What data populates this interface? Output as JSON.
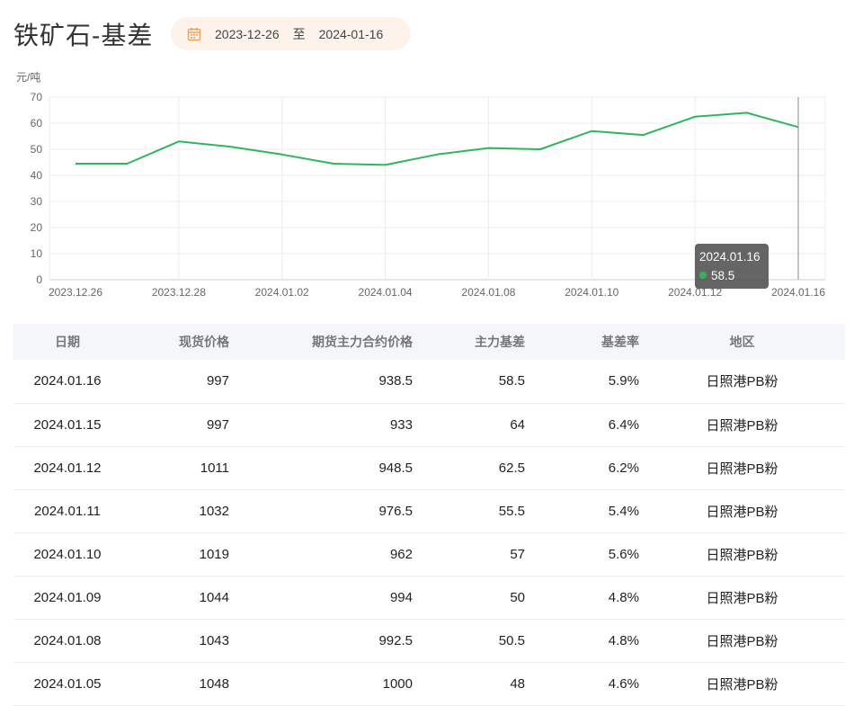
{
  "header": {
    "title": "铁矿石-基差",
    "date_start": "2023-12-26",
    "date_sep": "至",
    "date_end": "2024-01-16"
  },
  "colors": {
    "line": "#2fb55d",
    "negative_text": "#e05252",
    "date_pill_bg": "#fdf3ea",
    "calendar_icon": "#e8a25a"
  },
  "chart_data": {
    "type": "line",
    "ylabel": "元/吨",
    "ylim": [
      0,
      70
    ],
    "yticks": [
      0,
      10,
      20,
      30,
      40,
      50,
      60,
      70
    ],
    "x": [
      "2023.12.26",
      "2023.12.27",
      "2023.12.28",
      "2023.12.29",
      "2024.01.02",
      "2024.01.03",
      "2024.01.04",
      "2024.01.05",
      "2024.01.08",
      "2024.01.09",
      "2024.01.10",
      "2024.01.11",
      "2024.01.12",
      "2024.01.15",
      "2024.01.16"
    ],
    "xtick_labels": [
      "2023.12.26",
      "2023.12.28",
      "2024.01.02",
      "2024.01.04",
      "2024.01.08",
      "2024.01.10",
      "2024.01.12",
      "2024.01.16"
    ],
    "series": [
      {
        "values": [
          44.5,
          44.5,
          53,
          51,
          48,
          44.5,
          44,
          48,
          50.5,
          50,
          57,
          55.5,
          62.5,
          64,
          58.5
        ]
      }
    ],
    "grid": true,
    "tooltip": {
      "date": "2024.01.16",
      "value": "58.5"
    }
  },
  "table": {
    "headers": [
      "日期",
      "现货价格",
      "期货主力合约价格",
      "主力基差",
      "基差率",
      "地区"
    ],
    "rows": [
      [
        "2024.01.16",
        "997",
        "938.5",
        "58.5",
        "5.9%",
        "日照港PB粉"
      ],
      [
        "2024.01.15",
        "997",
        "933",
        "64",
        "6.4%",
        "日照港PB粉"
      ],
      [
        "2024.01.12",
        "1011",
        "948.5",
        "62.5",
        "6.2%",
        "日照港PB粉"
      ],
      [
        "2024.01.11",
        "1032",
        "976.5",
        "55.5",
        "5.4%",
        "日照港PB粉"
      ],
      [
        "2024.01.10",
        "1019",
        "962",
        "57",
        "5.6%",
        "日照港PB粉"
      ],
      [
        "2024.01.09",
        "1044",
        "994",
        "50",
        "4.8%",
        "日照港PB粉"
      ],
      [
        "2024.01.08",
        "1043",
        "992.5",
        "50.5",
        "4.8%",
        "日照港PB粉"
      ],
      [
        "2024.01.05",
        "1048",
        "1000",
        "48",
        "4.6%",
        "日照港PB粉"
      ]
    ]
  }
}
